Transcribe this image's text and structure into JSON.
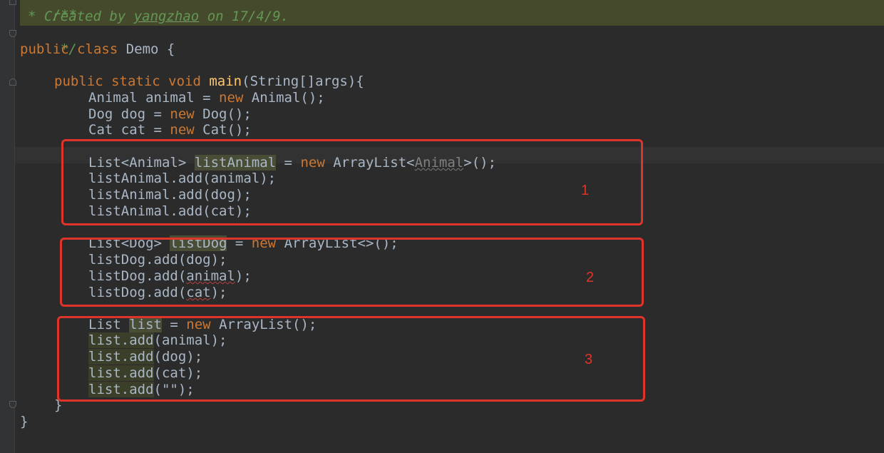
{
  "code": {
    "comment_open": "/**",
    "comment_created": "Created by",
    "comment_author": "yangzhao",
    "comment_date": "on 17/4/9.",
    "comment_close": "*/",
    "class_decl": {
      "kw": "public class",
      "name": "Demo {"
    },
    "main_decl": {
      "kw": "public static void",
      "fn": "main",
      "args": "(String[]args){"
    },
    "animal_line": {
      "a": "Animal animal = ",
      "kw": "new",
      "b": " Animal();"
    },
    "dog_line": {
      "a": "Dog dog = ",
      "kw": "new",
      "b": " Dog();"
    },
    "cat_line": {
      "a": "Cat cat = ",
      "kw": "new",
      "b": " Cat();"
    },
    "list_animal_decl": {
      "a": "List<Animal> ",
      "var": "listAnimal",
      "b": " = ",
      "kw": "new",
      "c": " ArrayList<",
      "gen": "Animal",
      "d": ">();"
    },
    "list_animal_add1": "listAnimal.add(animal);",
    "list_animal_add2": "listAnimal.add(dog);",
    "list_animal_add3": "listAnimal.add(cat);",
    "list_dog_decl": {
      "a": "List<Dog> ",
      "var": "listDog",
      "b": " = ",
      "kw": "new",
      "c": " ArrayList<>();"
    },
    "list_dog_add1": "listDog.add(dog);",
    "list_dog_add2": {
      "a": "listDog.add(",
      "err": "animal",
      "b": ");"
    },
    "list_dog_add3": {
      "a": "listDog.add(",
      "err": "cat",
      "b": ");"
    },
    "raw_list_decl": {
      "a": "List ",
      "var": "list",
      "b": " = ",
      "kw": "new",
      "c": " ArrayList();"
    },
    "raw_add1": {
      "hl": "list.add",
      "b": "(animal);"
    },
    "raw_add2": {
      "hl": "list.add",
      "b": "(dog);"
    },
    "raw_add3": {
      "hl": "list.add",
      "b": "(cat);"
    },
    "raw_add4": {
      "hl": "list.add",
      "b": "(\"\");"
    },
    "close_method": "}",
    "close_class": "}"
  },
  "annotations": [
    {
      "label": "1"
    },
    {
      "label": "2"
    },
    {
      "label": "3"
    }
  ],
  "colors": {
    "background": "#2b2b2b",
    "keyword": "#cc7832",
    "method": "#ffc66d",
    "comment": "#629755",
    "annotation_red": "#e0342a"
  }
}
